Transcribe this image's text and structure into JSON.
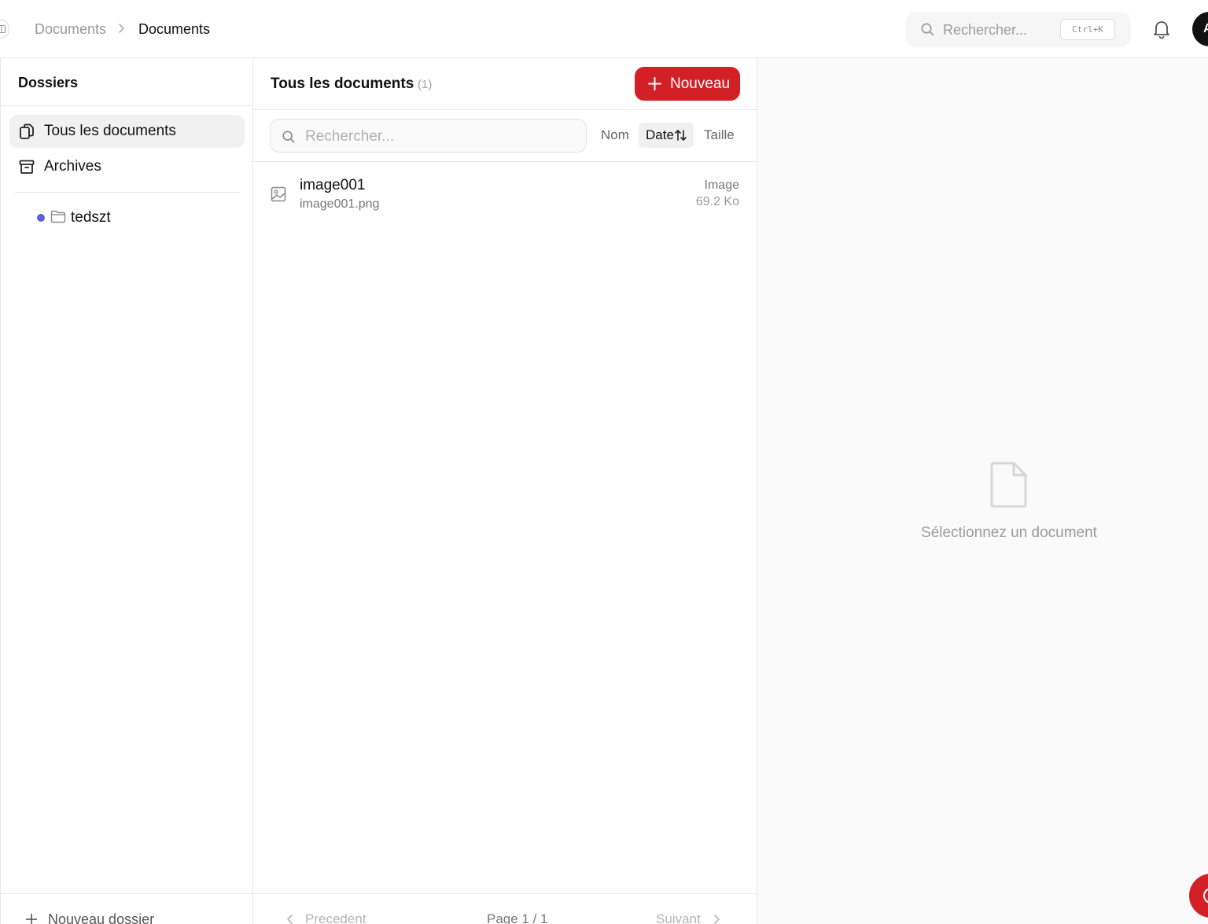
{
  "header": {
    "breadcrumb": [
      "Documents",
      "Documents"
    ],
    "search_placeholder": "Rechercher...",
    "search_shortcut": "Ctrl+K",
    "avatar_initial": "A"
  },
  "sidebar": {
    "title": "Dossiers",
    "items": [
      {
        "label": "Tous les documents",
        "icon": "documents-icon",
        "active": true
      },
      {
        "label": "Archives",
        "icon": "archive-icon",
        "active": false
      }
    ],
    "folders": [
      {
        "label": "tedszt",
        "dot_color": "#5b5fe0",
        "icon": "folder-icon"
      }
    ],
    "new_folder_label": "Nouveau dossier"
  },
  "list": {
    "title": "Tous les documents",
    "count": "(1)",
    "new_button_label": "Nouveau",
    "search_placeholder": "Rechercher...",
    "sort_options": [
      "Nom",
      "Date",
      "Taille"
    ],
    "active_sort": "Date",
    "documents": [
      {
        "name": "image001",
        "filename": "image001.png",
        "type": "Image",
        "size": "69.2 Ko",
        "icon": "image-icon"
      }
    ],
    "pagination": {
      "prev": "Precedent",
      "page": "Page 1 / 1",
      "next": "Suivant"
    }
  },
  "preview": {
    "empty_text": "Sélectionnez un document",
    "icon": "file-icon"
  },
  "colors": {
    "accent": "#d32027",
    "folder_dot": "#5b5fe0"
  }
}
